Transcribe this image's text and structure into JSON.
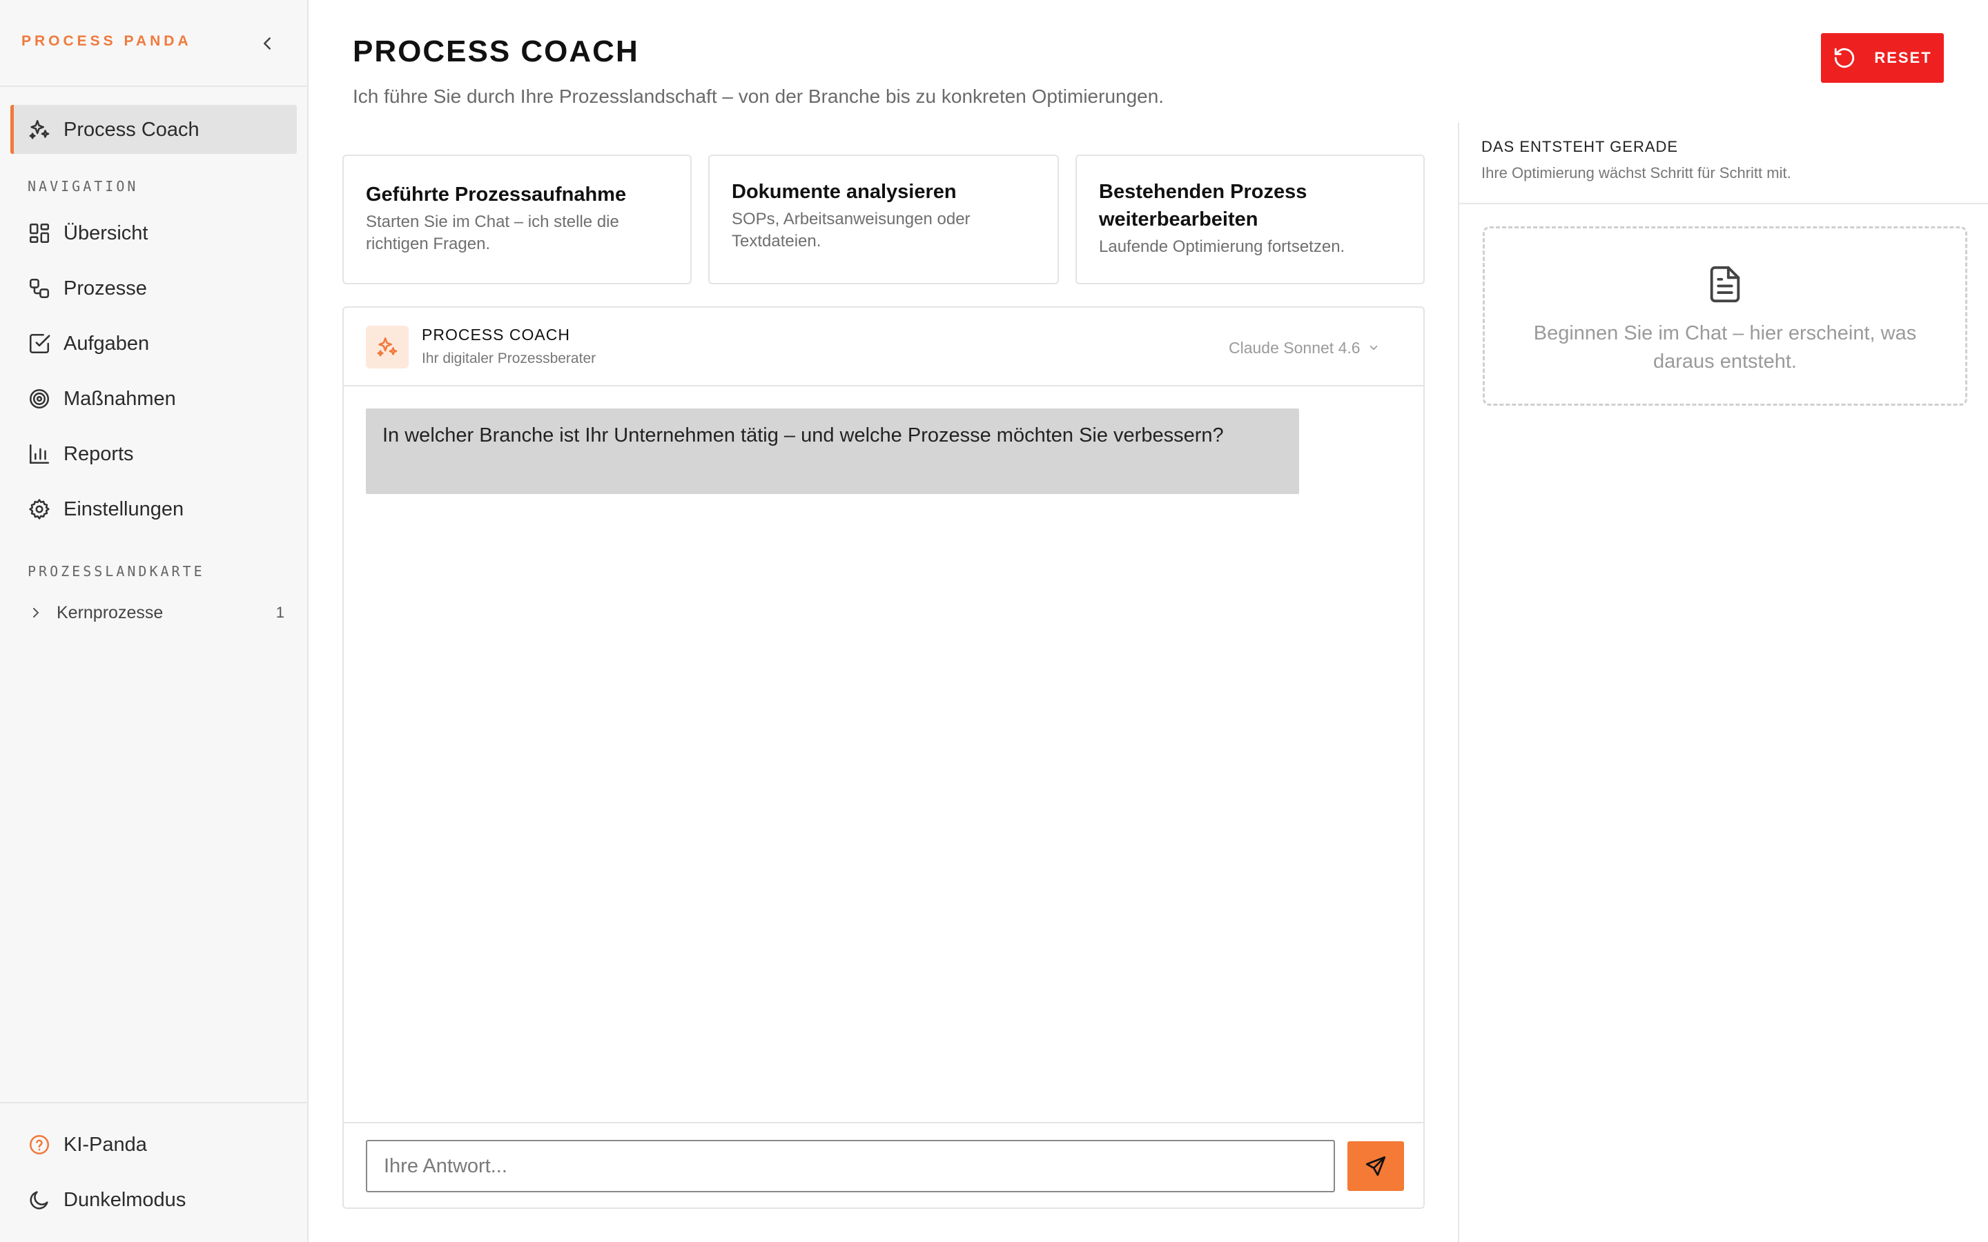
{
  "sidebar": {
    "brand": "PROCESS PANDA",
    "active_item": {
      "label": "Process Coach",
      "icon": "sparkles-icon"
    },
    "navigation_label": "NAVIGATION",
    "items": [
      {
        "label": "Übersicht",
        "icon": "dashboard-icon"
      },
      {
        "label": "Prozesse",
        "icon": "workflow-icon"
      },
      {
        "label": "Aufgaben",
        "icon": "checkbox-icon"
      },
      {
        "label": "Maßnahmen",
        "icon": "target-icon"
      },
      {
        "label": "Reports",
        "icon": "bar-chart-icon"
      },
      {
        "label": "Einstellungen",
        "icon": "gear-icon"
      }
    ],
    "map_label": "PROZESSLANDKARTE",
    "map_items": [
      {
        "label": "Kernprozesse",
        "count": "1"
      }
    ],
    "footer": [
      {
        "label": "KI-Panda",
        "icon": "help-circle-icon",
        "icon_color": "#f07a3c"
      },
      {
        "label": "Dunkelmodus",
        "icon": "moon-icon"
      }
    ]
  },
  "header": {
    "title": "PROCESS COACH",
    "subtitle": "Ich führe Sie durch Ihre Prozesslandschaft – von der Branche bis zu konkreten Optimierungen.",
    "reset_label": "RESET"
  },
  "cards": [
    {
      "title": "Geführte Prozessaufnahme",
      "desc": "Starten Sie im Chat – ich stelle die richtigen Fragen."
    },
    {
      "title": "Dokumente analysieren",
      "desc": "SOPs, Arbeitsanweisungen oder Textdateien."
    },
    {
      "title": "Bestehenden Prozess weiterbearbeiten",
      "desc": "Laufende Optimierung fortsetzen."
    }
  ],
  "chat": {
    "coach_name": "PROCESS COACH",
    "coach_role": "Ihr digitaler Prozessberater",
    "model": "Claude Sonnet 4.6",
    "messages": [
      {
        "text": "In welcher Branche ist Ihr Unternehmen tätig – und welche Prozesse möchten Sie verbessern?"
      }
    ],
    "input_placeholder": "Ihre Antwort..."
  },
  "right_panel": {
    "title": "DAS ENTSTEHT GERADE",
    "subtitle": "Ihre Optimierung wächst Schritt für Schritt mit.",
    "empty_text": "Beginnen Sie im Chat – hier erscheint, was daraus entsteht."
  },
  "colors": {
    "accent": "#f07a3c",
    "reset": "#ef2020",
    "send": "#f47a35",
    "bubble": "#d5d5d6"
  }
}
